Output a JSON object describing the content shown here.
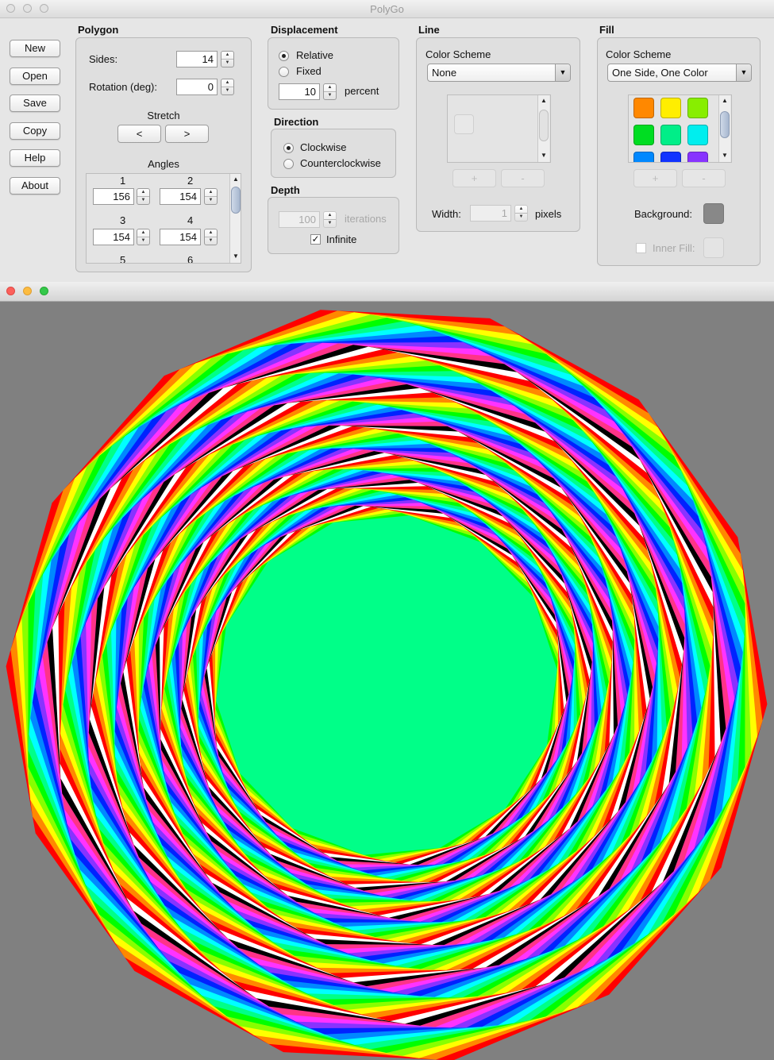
{
  "window": {
    "title": "PolyGo"
  },
  "buttons": [
    "New",
    "Open",
    "Save",
    "Copy",
    "Help",
    "About"
  ],
  "polygon": {
    "heading": "Polygon",
    "sides_label": "Sides:",
    "sides_value": "14",
    "rotation_label": "Rotation (deg):",
    "rotation_value": "0",
    "stretch_label": "Stretch",
    "stretch_left": "<",
    "stretch_right": ">",
    "angles_label": "Angles",
    "angles": [
      {
        "index": "1",
        "value": "156"
      },
      {
        "index": "2",
        "value": "154"
      },
      {
        "index": "3",
        "value": "154"
      },
      {
        "index": "4",
        "value": "154"
      },
      {
        "index": "5",
        "value": ""
      },
      {
        "index": "6",
        "value": ""
      }
    ]
  },
  "displacement": {
    "heading": "Displacement",
    "options": [
      "Relative",
      "Fixed"
    ],
    "selected": "Relative",
    "value": "10",
    "unit": "percent"
  },
  "direction": {
    "heading": "Direction",
    "options": [
      "Clockwise",
      "Counterclockwise"
    ],
    "selected": "Clockwise"
  },
  "depth": {
    "heading": "Depth",
    "value": "100",
    "unit": "iterations",
    "infinite_label": "Infinite",
    "infinite_checked": true
  },
  "line": {
    "heading": "Line",
    "color_scheme_label": "Color Scheme",
    "color_scheme_value": "None",
    "add": "+",
    "remove": "-",
    "width_label": "Width:",
    "width_value": "1",
    "width_unit": "pixels"
  },
  "fill": {
    "heading": "Fill",
    "color_scheme_label": "Color Scheme",
    "color_scheme_value": "One Side, One Color",
    "swatches": [
      "#ff8800",
      "#ffee00",
      "#88ee00",
      "#00dd22",
      "#00ee88",
      "#00eeee",
      "#0088ff",
      "#1133ff",
      "#8833ff"
    ],
    "add": "+",
    "remove": "-",
    "background_label": "Background:",
    "inner_fill_label": "Inner Fill:"
  },
  "canvas": {
    "background": "#808080",
    "palette": [
      "#ff0000",
      "#ff8800",
      "#ffff00",
      "#88ff00",
      "#00ff00",
      "#00ff88",
      "#00ffff",
      "#0088ff",
      "#0022ff",
      "#8833ff",
      "#ff33ff",
      "#ff3388",
      "#000000",
      "#ffffff"
    ],
    "sides": 14,
    "displacement_percent": 10
  }
}
